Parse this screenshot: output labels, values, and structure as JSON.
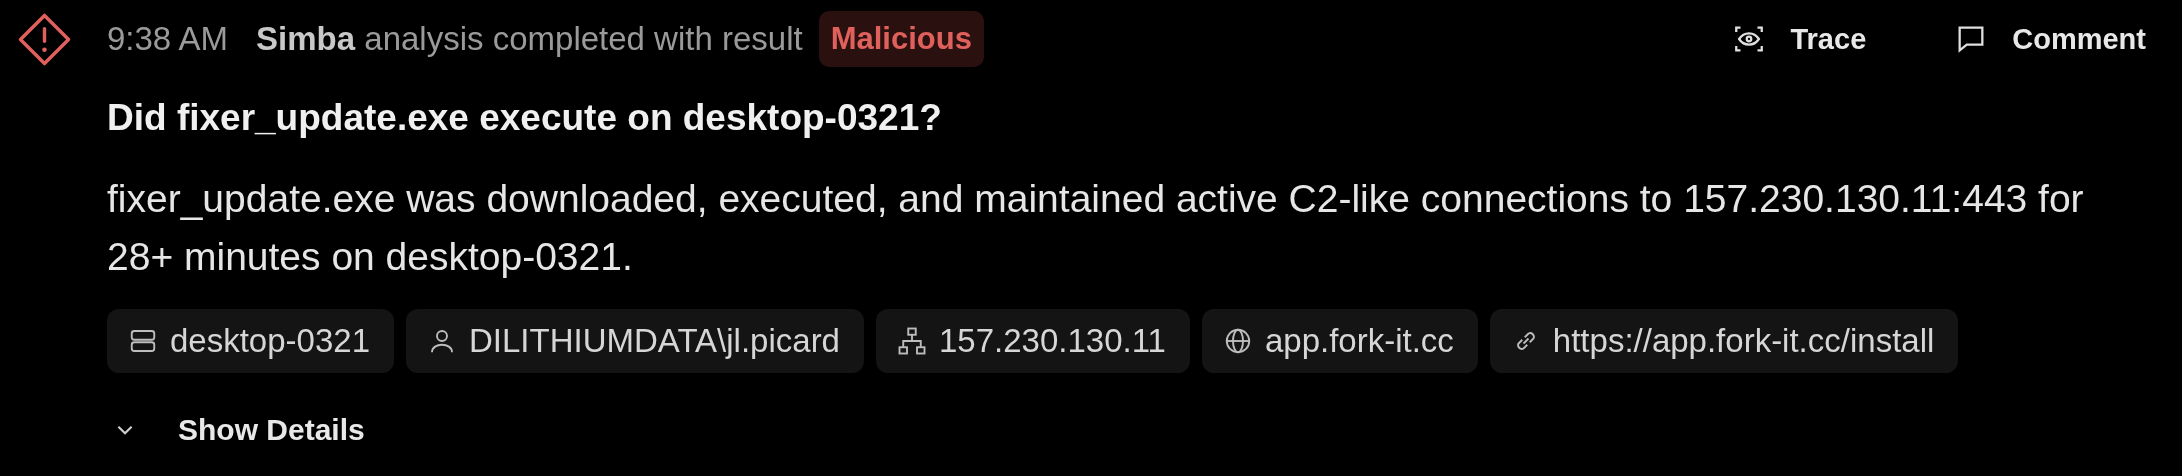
{
  "event": {
    "kind": "malicious",
    "time": "9:38 AM",
    "message": "**Simba** analysis completed with result",
    "result": "Malicious"
  },
  "actions": [
    {
      "kind": "trace",
      "label": "Trace"
    },
    {
      "kind": "comment",
      "label": "Comment"
    }
  ],
  "question": "Did fixer_update.exe execute on desktop-0321?",
  "answer": "fixer_update.exe was downloaded, executed, and maintained active C2-like connections to 157.230.130.11:443 for 28+ minutes on desktop-0321.",
  "entities": [
    {
      "kind": "host",
      "label": "desktop-0321"
    },
    {
      "kind": "user",
      "label": "DILITHIUMDATA\\jl.picard"
    },
    {
      "kind": "ip",
      "label": "157.230.130.11"
    },
    {
      "kind": "domain",
      "label": "app.fork-it.cc"
    },
    {
      "kind": "url",
      "label": "https://app.fork-it.cc/install"
    }
  ],
  "details": {
    "label": "Show Details",
    "expanded": false
  }
}
